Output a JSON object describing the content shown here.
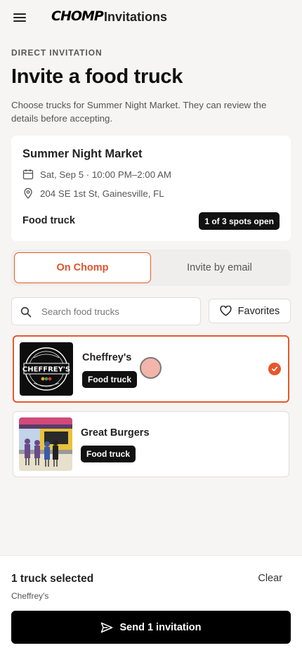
{
  "header": {
    "logo_text": "CHOMP",
    "title": "Invitations",
    "menu_icon": "hamburger-menu-icon"
  },
  "page": {
    "eyebrow": "DIRECT INVITATION",
    "title": "Invite a food truck",
    "subtitle": "Choose trucks for Summer Night Market. They can review the details before accepting."
  },
  "event": {
    "name": "Summer Night Market",
    "datetime": "Sat, Sep 5 · 10:00 PM–2:00 AM",
    "location": "204 SE 1st St, Gainesville, FL",
    "type_label": "Food truck",
    "spots_badge": "1 of 3 spots open"
  },
  "tabs": [
    {
      "label": "On Chomp",
      "active": true
    },
    {
      "label": "Invite by email",
      "active": false
    }
  ],
  "search": {
    "placeholder": "Search food trucks",
    "value": ""
  },
  "favorites_label": "Favorites",
  "trucks": [
    {
      "name": "Cheffrey's",
      "badge": "Food truck",
      "selected": true,
      "logo_text": "CHEFFREY'S"
    },
    {
      "name": "Great Burgers",
      "badge": "Food truck",
      "selected": false
    }
  ],
  "footer": {
    "selected_count": "1 truck selected",
    "selected_names": "Cheffrey's",
    "clear_label": "Clear",
    "send_label": "Send 1 invitation"
  },
  "colors": {
    "accent": "#e8572a",
    "background": "#f6f5f3",
    "primary_button": "#000000"
  }
}
